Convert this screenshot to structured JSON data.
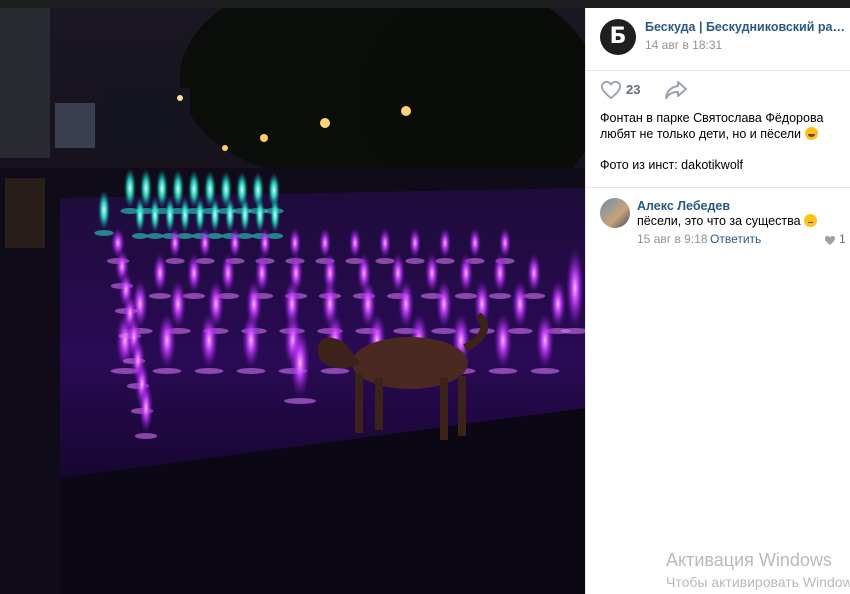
{
  "post": {
    "group_name": "Бескуда | Бескудниковский район ...",
    "avatar_glyph": "Б",
    "date": "14 авг в 18:31",
    "likes": "23",
    "text": "Фонтан в парке Святослава Фёдорова любят не только дети, но и пёсели",
    "credit": "Фото из инст: dakotikwolf"
  },
  "comment": {
    "author": "Алекс Лебедев",
    "text": "пёсели, это что за существа",
    "date": "15 авг в 9:18",
    "reply_label": "Ответить",
    "likes": "1"
  },
  "watermark": {
    "title": "Активация Windows",
    "subtitle": "Чтобы активировать Windows"
  },
  "icons": {
    "like": "heart-icon",
    "share": "share-arrow-icon",
    "emoji_post": "grinning-face-emoji",
    "emoji_comment": "thinking-face-emoji"
  },
  "colors": {
    "link": "#2a5885",
    "muted": "#939393",
    "fountain_magenta": "#c53cff",
    "fountain_cyan": "#29e5d0"
  }
}
